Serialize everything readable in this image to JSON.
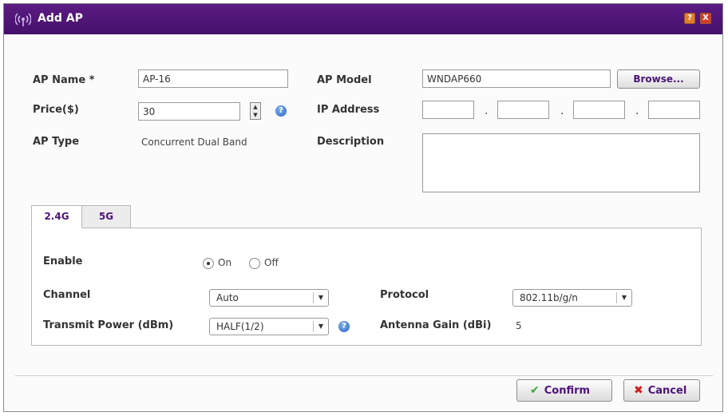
{
  "window": {
    "title": "Add AP",
    "help_glyph": "?",
    "close_glyph": "X",
    "icons": {
      "title": "wifi-antenna-icon",
      "help": "help-icon",
      "close": "close-icon"
    }
  },
  "form": {
    "ap_name": {
      "label": "AP Name *",
      "value": "AP-16"
    },
    "ap_model": {
      "label": "AP Model",
      "value": "WNDAP660",
      "browse_label": "Browse..."
    },
    "price": {
      "label": "Price($)",
      "value": "30"
    },
    "ip_address": {
      "label": "IP Address",
      "octets": [
        "",
        "",
        "",
        ""
      ],
      "separator": "."
    },
    "ap_type": {
      "label": "AP Type",
      "value": "Concurrent Dual Band"
    },
    "description": {
      "label": "Description",
      "value": ""
    }
  },
  "tabs": [
    {
      "label": "2.4G",
      "active": true
    },
    {
      "label": "5G",
      "active": false
    }
  ],
  "panel": {
    "enable": {
      "label": "Enable",
      "options": [
        "On",
        "Off"
      ],
      "selected": "On"
    },
    "channel": {
      "label": "Channel",
      "value": "Auto"
    },
    "protocol": {
      "label": "Protocol",
      "value": "802.11b/g/n"
    },
    "transmit_power": {
      "label": "Transmit Power (dBm)",
      "value": "HALF(1/2)"
    },
    "antenna_gain": {
      "label": "Antenna Gain (dBi)",
      "value": "5"
    }
  },
  "footer": {
    "confirm_label": "Confirm",
    "cancel_label": "Cancel"
  },
  "colors": {
    "titlebar": "#4f1677",
    "accent_text": "#4d1477",
    "confirm_icon": "#3aa53a",
    "cancel_icon": "#c82020"
  }
}
